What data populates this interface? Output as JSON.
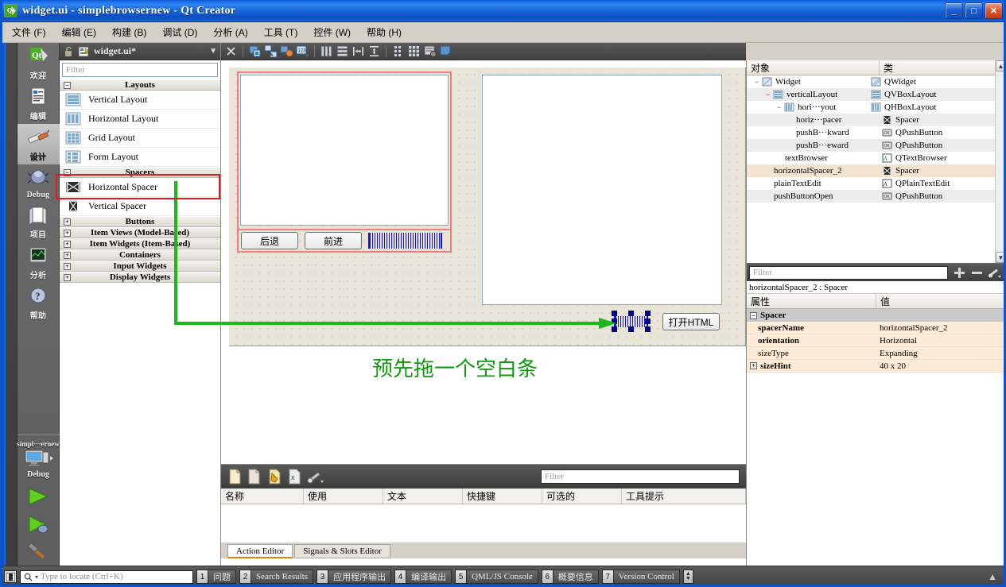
{
  "window": {
    "title": "widget.ui - simplebrowsernew - Qt Creator",
    "app_icon": "qt-logo-icon",
    "minimize": "_",
    "maximize": "□",
    "close": "✕"
  },
  "menubar": {
    "items": [
      {
        "label": "文件 (F)",
        "name": "menu-file"
      },
      {
        "label": "编辑 (E)",
        "name": "menu-edit"
      },
      {
        "label": "构建 (B)",
        "name": "menu-build"
      },
      {
        "label": "调试 (D)",
        "name": "menu-debug"
      },
      {
        "label": "分析 (A)",
        "name": "menu-analyze"
      },
      {
        "label": "工具 (T)",
        "name": "menu-tools"
      },
      {
        "label": "控件 (W)",
        "name": "menu-window"
      },
      {
        "label": "帮助 (H)",
        "name": "menu-help"
      }
    ]
  },
  "modebar": {
    "modes": [
      {
        "label": "欢迎",
        "icon": "welcome-icon",
        "active": false
      },
      {
        "label": "编辑",
        "icon": "edit-icon",
        "active": false
      },
      {
        "label": "设计",
        "icon": "design-icon",
        "active": true
      },
      {
        "label": "Debug",
        "icon": "debug-bug-icon",
        "active": false
      },
      {
        "label": "项目",
        "icon": "projects-icon",
        "active": false
      },
      {
        "label": "分析",
        "icon": "analyze-icon",
        "active": false
      },
      {
        "label": "帮助",
        "icon": "help-icon",
        "active": false
      }
    ],
    "kit": {
      "project_name": "simpl···ernew",
      "build_config": "Debug",
      "icon": "target-computer-icon",
      "run_button": "run-icon",
      "debug_button": "start-debug-icon",
      "build_button": "build-hammer-icon"
    }
  },
  "widgetbox": {
    "file_tab": "widget.ui*",
    "lock_icon": "lock-open-icon",
    "file_icon": "ui-file-icon",
    "dropdown_icon": "chevron-down-icon",
    "filter_placeholder": "Filter",
    "sections": [
      {
        "title": "Layouts",
        "expanded": true,
        "toggle": "−",
        "items": [
          {
            "label": "Vertical Layout",
            "icon": "vertical-layout-icon"
          },
          {
            "label": "Horizontal Layout",
            "icon": "horizontal-layout-icon"
          },
          {
            "label": "Grid Layout",
            "icon": "grid-layout-icon"
          },
          {
            "label": "Form Layout",
            "icon": "form-layout-icon"
          }
        ]
      },
      {
        "title": "Spacers",
        "expanded": true,
        "toggle": "−",
        "items": [
          {
            "label": "Horizontal Spacer",
            "icon": "horizontal-spacer-icon",
            "highlighted": true
          },
          {
            "label": "Vertical Spacer",
            "icon": "vertical-spacer-icon"
          }
        ]
      },
      {
        "title": "Buttons",
        "expanded": false,
        "toggle": "+",
        "items": []
      },
      {
        "title": "Item Views (Model-Based)",
        "expanded": false,
        "toggle": "+",
        "items": []
      },
      {
        "title": "Item Widgets (Item-Based)",
        "expanded": false,
        "toggle": "+",
        "items": []
      },
      {
        "title": "Containers",
        "expanded": false,
        "toggle": "+",
        "items": []
      },
      {
        "title": "Input Widgets",
        "expanded": false,
        "toggle": "+",
        "items": []
      },
      {
        "title": "Display Widgets",
        "expanded": false,
        "toggle": "+",
        "items": []
      }
    ]
  },
  "designer_toolbar": {
    "buttons": [
      {
        "name": "edit-widgets-icon",
        "title": "Edit Widgets"
      },
      {
        "name": "edit-signals-slots-icon",
        "title": "Edit Signals/Slots"
      },
      {
        "name": "edit-buddies-icon",
        "title": "Edit Buddies"
      },
      {
        "name": "edit-tab-order-icon",
        "title": "Edit Tab Order"
      },
      {
        "name": "layout-horizontally-icon",
        "title": "Lay Out Horizontally"
      },
      {
        "name": "layout-vertically-icon",
        "title": "Lay Out Vertically"
      },
      {
        "name": "layout-splitter-h-icon",
        "title": "Lay Out Horizontally in Splitter"
      },
      {
        "name": "layout-splitter-v-icon",
        "title": "Lay Out Vertically in Splitter"
      },
      {
        "name": "layout-form-icon",
        "title": "Lay Out in Form Layout"
      },
      {
        "name": "layout-grid-icon",
        "title": "Lay Out in Grid"
      },
      {
        "name": "break-layout-icon",
        "title": "Break Layout"
      },
      {
        "name": "adjust-size-icon",
        "title": "Adjust Size"
      }
    ]
  },
  "form": {
    "left_panel": {
      "text_browser": "textBrowser",
      "buttons": [
        {
          "label": "后退",
          "name": "pushButtonBackward"
        },
        {
          "label": "前进",
          "name": "pushButtonForward"
        }
      ],
      "spacer": "horizontalSpacer"
    },
    "right_panel": {
      "plain_text_edit": "plainTextEdit",
      "spacer": "horizontalSpacer_2",
      "button": {
        "label": "打开HTML",
        "name": "pushButtonOpen"
      }
    },
    "annotation": "预先拖一个空白条",
    "annotation_color": "#119911",
    "highlight_color": "#e01b1b"
  },
  "action_editor": {
    "toolbar": [
      {
        "name": "new-action-icon"
      },
      {
        "name": "copy-action-icon"
      },
      {
        "name": "edit-action-icon"
      },
      {
        "name": "delete-action-icon"
      },
      {
        "name": "configure-icon"
      }
    ],
    "filter_placeholder": "Filter",
    "columns": [
      "名称",
      "使用",
      "文本",
      "快捷键",
      "可选的",
      "工具提示"
    ],
    "rows": [],
    "tabs": [
      {
        "label": "Action Editor",
        "active": true
      },
      {
        "label": "Signals & Slots Editor",
        "active": false
      }
    ]
  },
  "object_inspector": {
    "columns": [
      "对象",
      "类"
    ],
    "rows": [
      {
        "name": "Widget",
        "class": "QWidget",
        "depth": 0,
        "icon": "qwidget-icon",
        "toggle": "−",
        "selected": false
      },
      {
        "name": "verticalLayout",
        "class": "QVBoxLayout",
        "depth": 1,
        "icon": "vbox-layout-icon",
        "toggle": "−",
        "selected": false
      },
      {
        "name": "hori···yout",
        "class": "QHBoxLayout",
        "depth": 2,
        "icon": "hbox-layout-icon",
        "toggle": "−",
        "selected": false
      },
      {
        "name": "horiz···pacer",
        "class": "Spacer",
        "depth": 3,
        "icon": "horizontal-spacer-icon",
        "toggle": "",
        "selected": false
      },
      {
        "name": "pushB···kward",
        "class": "QPushButton",
        "depth": 3,
        "icon": "pushbutton-icon",
        "toggle": "",
        "selected": false
      },
      {
        "name": "pushB···eward",
        "class": "QPushButton",
        "depth": 3,
        "icon": "pushbutton-icon",
        "toggle": "",
        "selected": false
      },
      {
        "name": "textBrowser",
        "class": "QTextBrowser",
        "depth": 2,
        "icon": "textbrowser-icon",
        "toggle": "",
        "selected": false
      },
      {
        "name": "horizontalSpacer_2",
        "class": "Spacer",
        "depth": 1,
        "icon": "horizontal-spacer-icon",
        "toggle": "",
        "selected": true
      },
      {
        "name": "plainTextEdit",
        "class": "QPlainTextEdit",
        "depth": 1,
        "icon": "plaintextedit-icon",
        "toggle": "",
        "selected": false
      },
      {
        "name": "pushButtonOpen",
        "class": "QPushButton",
        "depth": 1,
        "icon": "pushbutton-icon",
        "toggle": "",
        "selected": false
      }
    ]
  },
  "property_editor": {
    "filter_placeholder": "Filter",
    "toolbar": [
      {
        "name": "add-property-icon",
        "glyph": "+"
      },
      {
        "name": "remove-property-icon",
        "glyph": "−"
      },
      {
        "name": "configure-property-icon",
        "glyph": "wrench"
      }
    ],
    "object_line": "horizontalSpacer_2 : Spacer",
    "columns": [
      "属性",
      "值"
    ],
    "group": {
      "label": "Spacer",
      "toggle": "−"
    },
    "properties": [
      {
        "name": "spacerName",
        "value": "horizontalSpacer_2",
        "bold": true,
        "toggle": ""
      },
      {
        "name": "orientation",
        "value": "Horizontal",
        "bold": true,
        "toggle": ""
      },
      {
        "name": "sizeType",
        "value": "Expanding",
        "bold": false,
        "toggle": ""
      },
      {
        "name": "sizeHint",
        "value": "40 x 20",
        "bold": true,
        "toggle": "+"
      }
    ]
  },
  "statusbar": {
    "toggle_sidebar_icon": "toggle-sidebar-icon",
    "locator": {
      "icon": "search-icon",
      "placeholder": "Type to locate (Ctrl+K)"
    },
    "panes": [
      {
        "num": "1",
        "label": "问题"
      },
      {
        "num": "2",
        "label": "Search Results"
      },
      {
        "num": "3",
        "label": "应用程序输出"
      },
      {
        "num": "4",
        "label": "编译输出"
      },
      {
        "num": "5",
        "label": "QML/JS Console"
      },
      {
        "num": "6",
        "label": "概要信息"
      },
      {
        "num": "7",
        "label": "Version Control"
      }
    ],
    "updown_icon": "updown-arrows-icon",
    "collapse_icon": "collapse-arrow-icon"
  }
}
